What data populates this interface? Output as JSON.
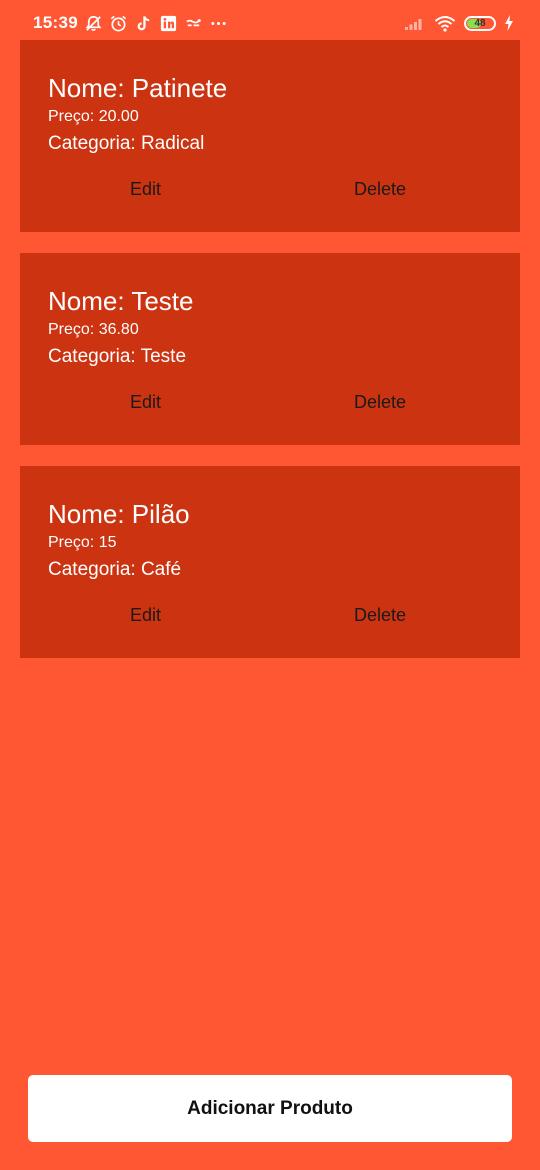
{
  "status_bar": {
    "time": "15:39",
    "left_icons": [
      "alarm-off-icon",
      "alarm-clock-icon",
      "tiktok-icon",
      "linkedin-icon",
      "app-notification-icon",
      "more-dots-icon"
    ],
    "right_icons": [
      "signal-icon",
      "wifi-icon",
      "battery-icon",
      "charging-icon"
    ],
    "battery_level": "48"
  },
  "products": [
    {
      "name": "Nome: Patinete",
      "price": "Preço: 20.00",
      "category": "Categoria: Radical",
      "edit_label": "Edit",
      "delete_label": "Delete"
    },
    {
      "name": "Nome: Teste",
      "price": "Preço: 36.80",
      "category": "Categoria: Teste",
      "edit_label": "Edit",
      "delete_label": "Delete"
    },
    {
      "name": "Nome: Pilão",
      "price": "Preço: 15",
      "category": "Categoria: Café",
      "edit_label": "Edit",
      "delete_label": "Delete"
    }
  ],
  "add_button_label": "Adicionar Produto",
  "colors": {
    "background": "#FF5733",
    "card": "#CC3311",
    "button": "#FFFFFF",
    "battery_fill": "#8BE04E"
  }
}
